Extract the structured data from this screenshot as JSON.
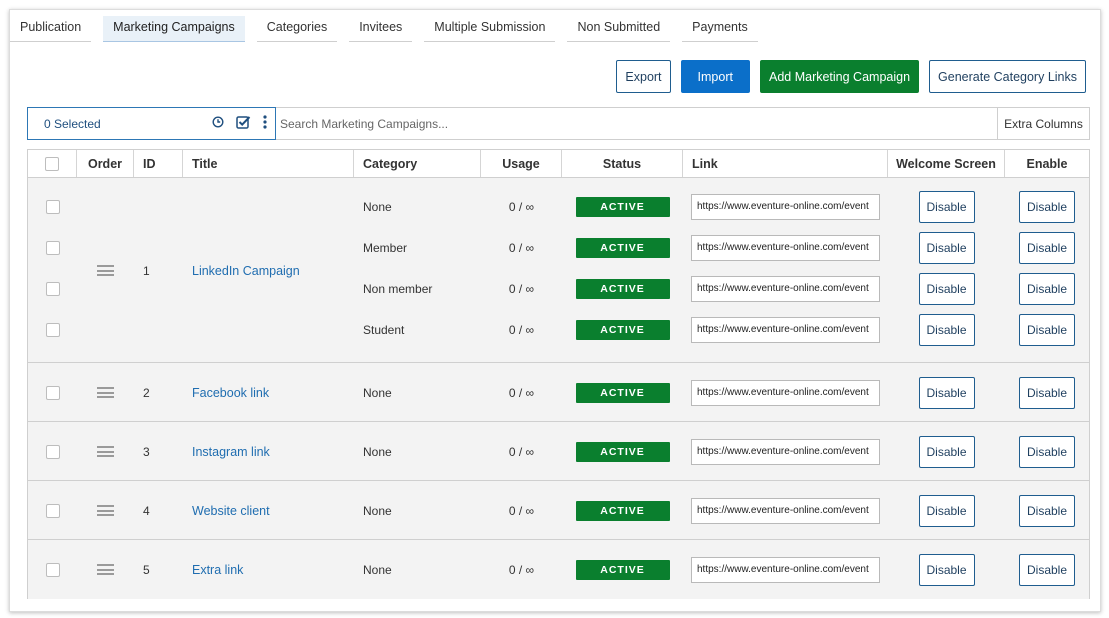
{
  "tabs": [
    {
      "label": "Publication",
      "active": false
    },
    {
      "label": "Marketing Campaigns",
      "active": true
    },
    {
      "label": "Categories",
      "active": false
    },
    {
      "label": "Invitees",
      "active": false
    },
    {
      "label": "Multiple Submission",
      "active": false
    },
    {
      "label": "Non Submitted",
      "active": false
    },
    {
      "label": "Payments",
      "active": false
    }
  ],
  "actions": {
    "export": "Export",
    "import": "Import",
    "add": "Add Marketing Campaign",
    "generate": "Generate Category Links"
  },
  "toolbar": {
    "selected": "0 Selected",
    "search_placeholder": "Search Marketing Campaigns...",
    "extra_columns": "Extra Columns"
  },
  "table": {
    "headers": {
      "order": "Order",
      "id": "ID",
      "title": "Title",
      "category": "Category",
      "usage": "Usage",
      "status": "Status",
      "link": "Link",
      "welcome": "Welcome Screen",
      "enable": "Enable"
    },
    "groups": [
      {
        "id": "1",
        "title": "LinkedIn Campaign",
        "rows": [
          {
            "category": "None",
            "usage": "0 / ∞",
            "status": "ACTIVE",
            "link": "https://www.eventure-online.com/event",
            "welcome": "Disable",
            "enable": "Disable"
          },
          {
            "category": "Member",
            "usage": "0 / ∞",
            "status": "ACTIVE",
            "link": "https://www.eventure-online.com/event",
            "welcome": "Disable",
            "enable": "Disable"
          },
          {
            "category": "Non member",
            "usage": "0 / ∞",
            "status": "ACTIVE",
            "link": "https://www.eventure-online.com/event",
            "welcome": "Disable",
            "enable": "Disable"
          },
          {
            "category": "Student",
            "usage": "0 / ∞",
            "status": "ACTIVE",
            "link": "https://www.eventure-online.com/event",
            "welcome": "Disable",
            "enable": "Disable"
          }
        ]
      },
      {
        "id": "2",
        "title": "Facebook link",
        "rows": [
          {
            "category": "None",
            "usage": "0 / ∞",
            "status": "ACTIVE",
            "link": "https://www.eventure-online.com/event",
            "welcome": "Disable",
            "enable": "Disable"
          }
        ]
      },
      {
        "id": "3",
        "title": "Instagram link",
        "rows": [
          {
            "category": "None",
            "usage": "0 / ∞",
            "status": "ACTIVE",
            "link": "https://www.eventure-online.com/event",
            "welcome": "Disable",
            "enable": "Disable"
          }
        ]
      },
      {
        "id": "4",
        "title": "Website client",
        "rows": [
          {
            "category": "None",
            "usage": "0 / ∞",
            "status": "ACTIVE",
            "link": "https://www.eventure-online.com/event",
            "welcome": "Disable",
            "enable": "Disable"
          }
        ]
      },
      {
        "id": "5",
        "title": "Extra link",
        "rows": [
          {
            "category": "None",
            "usage": "0 / ∞",
            "status": "ACTIVE",
            "link": "https://www.eventure-online.com/event",
            "welcome": "Disable",
            "enable": "Disable"
          }
        ]
      }
    ]
  },
  "colors": {
    "accent_blue": "#0b6fc9",
    "status_green": "#0a7f2e",
    "link_blue": "#1f6db0"
  },
  "icons": [
    "history-icon",
    "check-square-icon",
    "more-vertical-icon",
    "drag-handle-icon"
  ]
}
